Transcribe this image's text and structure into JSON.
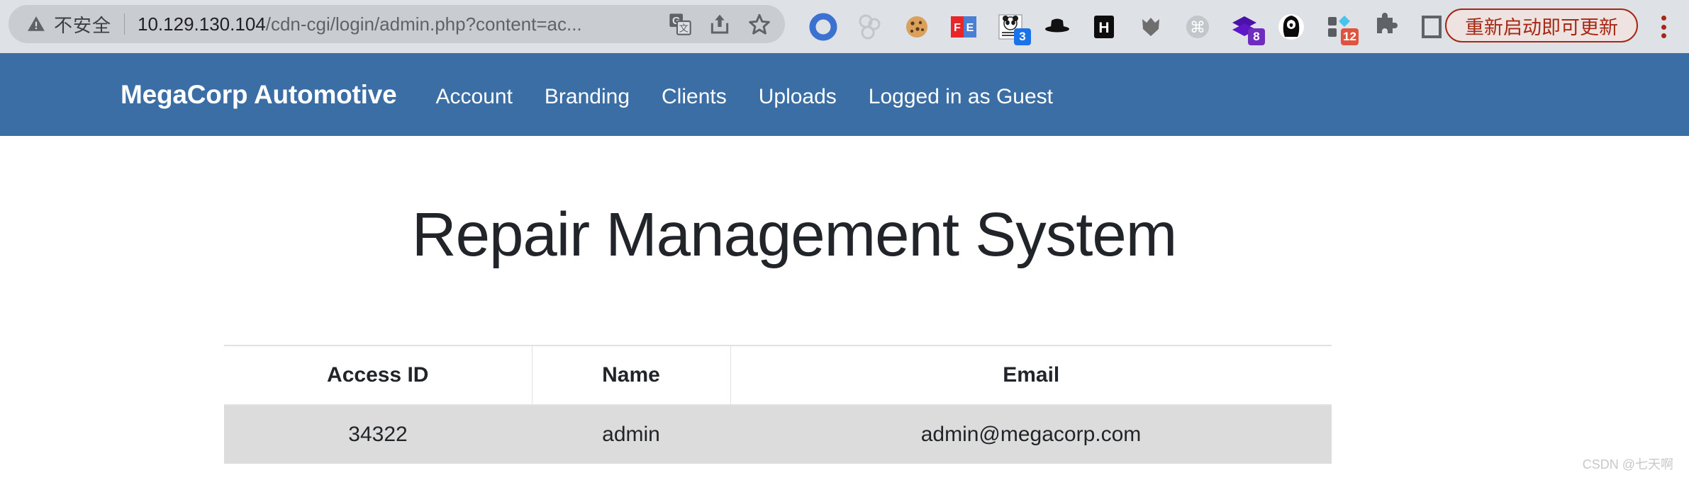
{
  "browser": {
    "security_label": "不安全",
    "security_icon": "warning-triangle-icon",
    "url_host": "10.129.130.104",
    "url_path": "/cdn-cgi/login/admin.php?content=ac...",
    "url_full": "10.129.130.104/cdn-cgi/login/admin.php?content=ac...",
    "omnibox_icons": [
      {
        "name": "translate-icon",
        "label": "Translate"
      },
      {
        "name": "share-icon",
        "label": "Share"
      },
      {
        "name": "bookmark-star-icon",
        "label": "Bookmark"
      }
    ],
    "extensions": [
      {
        "name": "blue-ring-extension-icon",
        "badge": ""
      },
      {
        "name": "molecule-extension-icon",
        "badge": ""
      },
      {
        "name": "cookie-extension-icon",
        "badge": ""
      },
      {
        "name": "fe-extension-icon",
        "badge": ""
      },
      {
        "name": "panda-photo-extension-icon",
        "badge": "3"
      },
      {
        "name": "black-hat-extension-icon",
        "badge": ""
      },
      {
        "name": "h-square-extension-icon",
        "badge": ""
      },
      {
        "name": "wolf-head-extension-icon",
        "badge": ""
      },
      {
        "name": "command-key-extension-icon",
        "badge": ""
      },
      {
        "name": "purple-layers-extension-icon",
        "badge": "8"
      },
      {
        "name": "hooded-figure-extension-icon",
        "badge": ""
      },
      {
        "name": "squares-diamond-extension-icon",
        "badge": "12"
      },
      {
        "name": "puzzle-piece-extensions-icon",
        "badge": ""
      },
      {
        "name": "square-outline-extension-icon",
        "badge": ""
      },
      {
        "name": "purple-panda-avatar-icon",
        "badge": ""
      }
    ],
    "update_button_label": "重新启动即可更新",
    "menu_icon": "kebab-menu-icon"
  },
  "navbar": {
    "brand": "MegaCorp Automotive",
    "links": [
      {
        "label": "Account"
      },
      {
        "label": "Branding"
      },
      {
        "label": "Clients"
      },
      {
        "label": "Uploads"
      },
      {
        "label": "Logged in as Guest"
      }
    ],
    "background_color": "#3b6ea5"
  },
  "main": {
    "title": "Repair Management System",
    "table": {
      "headers": [
        "Access ID",
        "Name",
        "Email"
      ],
      "rows": [
        {
          "access_id": "34322",
          "name": "admin",
          "email": "admin@megacorp.com"
        }
      ],
      "stripe_color": "#dcdcdc",
      "border_color": "#dee2e6"
    }
  },
  "watermark": "CSDN @七天啊"
}
